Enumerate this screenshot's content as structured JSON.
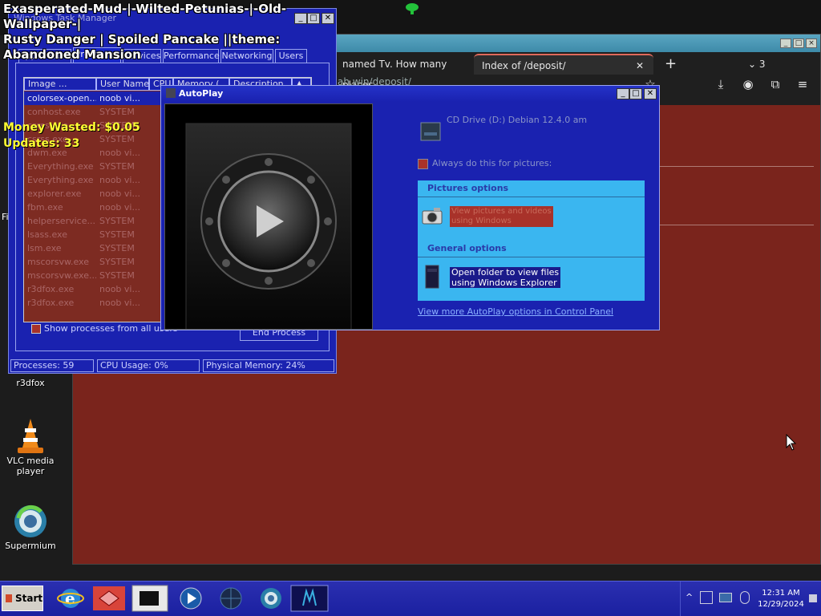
{
  "overlay": {
    "title_line1": "Exasperated-Mud-|-Wilted-Petunias-|-Old-Wallpaper-|",
    "title_line2": "Rusty Danger | Spoiled Pancake ||theme:",
    "title_line3": "Abandoned Mansion",
    "money_wasted": "Money Wasted: $0.05",
    "updates": "Updates: 33"
  },
  "browser": {
    "tab1_label": "named Tv. How many places",
    "tab2_label": "Index of /deposit/",
    "tab_count": "3",
    "url_fragment": "ah.win/deposit/"
  },
  "taskmgr": {
    "title": "Windows Task Manager",
    "tabs": [
      "Applications",
      "Processes",
      "Services",
      "Performance",
      "Networking",
      "Users"
    ],
    "columns": [
      "Image ...",
      "User Name",
      "CPU",
      "Memory (...",
      "Description"
    ],
    "rows": [
      {
        "name": "colorsex-open...",
        "user": "noob vi..."
      },
      {
        "name": "conhost.exe",
        "user": "SYSTEM"
      },
      {
        "name": "csrss.exe",
        "user": "SYSTEM"
      },
      {
        "name": "csrss.exe",
        "user": "SYSTEM"
      },
      {
        "name": "dwm.exe",
        "user": "noob vi..."
      },
      {
        "name": "Everything.exe",
        "user": "SYSTEM"
      },
      {
        "name": "Everything.exe",
        "user": "noob vi..."
      },
      {
        "name": "explorer.exe",
        "user": "noob vi..."
      },
      {
        "name": "fbm.exe",
        "user": "noob vi..."
      },
      {
        "name": "helperservice...",
        "user": "SYSTEM"
      },
      {
        "name": "lsass.exe",
        "user": "SYSTEM"
      },
      {
        "name": "lsm.exe",
        "user": "SYSTEM"
      },
      {
        "name": "mscorsvw.exe",
        "user": "SYSTEM"
      },
      {
        "name": "mscorsvw.exe...",
        "user": "SYSTEM"
      },
      {
        "name": "r3dfox.exe",
        "user": "noob vi..."
      },
      {
        "name": "r3dfox.exe",
        "user": "noob vi..."
      }
    ],
    "show_all_label": "Show processes from all users",
    "end_process_label": "End Process",
    "status_processes": "Processes: 59",
    "status_cpu": "CPU Usage: 0%",
    "status_memory": "Physical Memory: 24%"
  },
  "autoplay": {
    "title": "AutoPlay",
    "drive_label": "CD Drive (D:) Debian 12.4.0 am",
    "always_label": "Always do this for pictures:",
    "pictures_header": "Pictures options",
    "view_pictures_label1": "View pictures and videos",
    "view_pictures_label2": "using Windows",
    "general_header": "General options",
    "open_folder_label1": "Open folder to view files",
    "open_folder_label2": "using Windows Explorer",
    "control_panel_link": "View more AutoPlay options in Control Panel"
  },
  "desktop": {
    "r3dfox_label": "r3dfox",
    "vlc_label1": "VLC media",
    "vlc_label2": "player",
    "supermium_label": "Supermium",
    "partial_label": "Fi"
  },
  "taskbar": {
    "start_label": "Start",
    "time": "12:31 AM",
    "date": "12/29/2024"
  },
  "colors": {
    "desktop_bg": "#7a241c",
    "window_blue": "#1a22b0",
    "autoplay_box": "#3ab6f0",
    "highlight_red": "#a8322a",
    "overlay_yellow": "#ffff33"
  }
}
